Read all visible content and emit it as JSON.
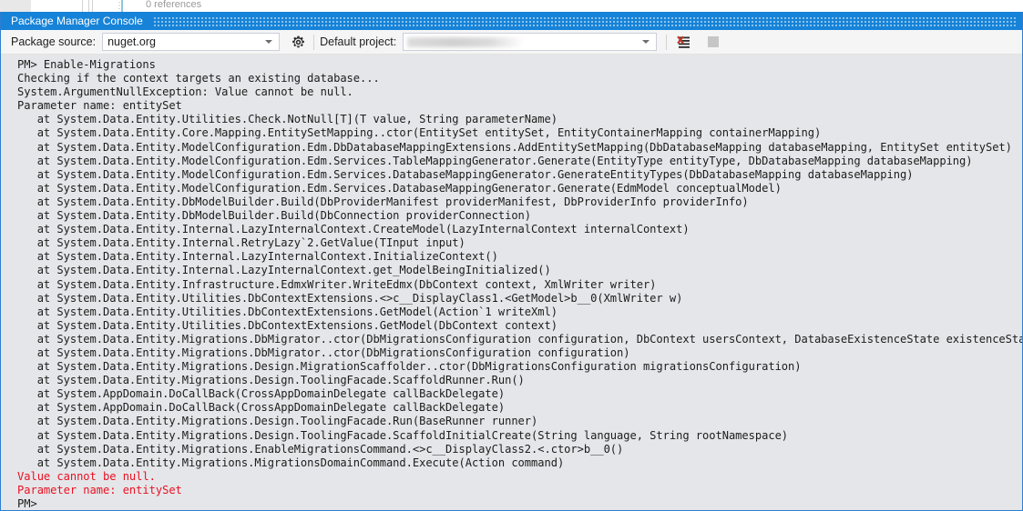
{
  "editor_sliver": {
    "codelens_text": "0 references",
    "dots_glyph": "⋮"
  },
  "toolwindow": {
    "title": "Package Manager Console",
    "title_bar_color": "#1683d8",
    "background_color": "#e5e6e9"
  },
  "toolbar": {
    "package_source_label": "Package source:",
    "package_source_value": "nuget.org",
    "package_source_placeholder": "Select package source",
    "settings_icon": "gear-icon",
    "default_project_label": "Default project:",
    "default_project_value": "",
    "default_project_placeholder": "Select project",
    "clear_console_icon": "clear-console-icon",
    "stop_icon": "stop-icon"
  },
  "console": {
    "error_color": "#e81123",
    "text_color": "#1c1c1c",
    "lines": [
      {
        "text": "PM> Enable-Migrations",
        "error": false
      },
      {
        "text": "Checking if the context targets an existing database...",
        "error": false
      },
      {
        "text": "System.ArgumentNullException: Value cannot be null.",
        "error": false
      },
      {
        "text": "Parameter name: entitySet",
        "error": false
      },
      {
        "text": "   at System.Data.Entity.Utilities.Check.NotNull[T](T value, String parameterName)",
        "error": false
      },
      {
        "text": "   at System.Data.Entity.Core.Mapping.EntitySetMapping..ctor(EntitySet entitySet, EntityContainerMapping containerMapping)",
        "error": false
      },
      {
        "text": "   at System.Data.Entity.ModelConfiguration.Edm.DbDatabaseMappingExtensions.AddEntitySetMapping(DbDatabaseMapping databaseMapping, EntitySet entitySet)",
        "error": false
      },
      {
        "text": "   at System.Data.Entity.ModelConfiguration.Edm.Services.TableMappingGenerator.Generate(EntityType entityType, DbDatabaseMapping databaseMapping)",
        "error": false
      },
      {
        "text": "   at System.Data.Entity.ModelConfiguration.Edm.Services.DatabaseMappingGenerator.GenerateEntityTypes(DbDatabaseMapping databaseMapping)",
        "error": false
      },
      {
        "text": "   at System.Data.Entity.ModelConfiguration.Edm.Services.DatabaseMappingGenerator.Generate(EdmModel conceptualModel)",
        "error": false
      },
      {
        "text": "   at System.Data.Entity.DbModelBuilder.Build(DbProviderManifest providerManifest, DbProviderInfo providerInfo)",
        "error": false
      },
      {
        "text": "   at System.Data.Entity.DbModelBuilder.Build(DbConnection providerConnection)",
        "error": false
      },
      {
        "text": "   at System.Data.Entity.Internal.LazyInternalContext.CreateModel(LazyInternalContext internalContext)",
        "error": false
      },
      {
        "text": "   at System.Data.Entity.Internal.RetryLazy`2.GetValue(TInput input)",
        "error": false
      },
      {
        "text": "   at System.Data.Entity.Internal.LazyInternalContext.InitializeContext()",
        "error": false
      },
      {
        "text": "   at System.Data.Entity.Internal.LazyInternalContext.get_ModelBeingInitialized()",
        "error": false
      },
      {
        "text": "   at System.Data.Entity.Infrastructure.EdmxWriter.WriteEdmx(DbContext context, XmlWriter writer)",
        "error": false
      },
      {
        "text": "   at System.Data.Entity.Utilities.DbContextExtensions.<>c__DisplayClass1.<GetModel>b__0(XmlWriter w)",
        "error": false
      },
      {
        "text": "   at System.Data.Entity.Utilities.DbContextExtensions.GetModel(Action`1 writeXml)",
        "error": false
      },
      {
        "text": "   at System.Data.Entity.Utilities.DbContextExtensions.GetModel(DbContext context)",
        "error": false
      },
      {
        "text": "   at System.Data.Entity.Migrations.DbMigrator..ctor(DbMigrationsConfiguration configuration, DbContext usersContext, DatabaseExistenceState existenceState)",
        "error": false
      },
      {
        "text": "   at System.Data.Entity.Migrations.DbMigrator..ctor(DbMigrationsConfiguration configuration)",
        "error": false
      },
      {
        "text": "   at System.Data.Entity.Migrations.Design.MigrationScaffolder..ctor(DbMigrationsConfiguration migrationsConfiguration)",
        "error": false
      },
      {
        "text": "   at System.Data.Entity.Migrations.Design.ToolingFacade.ScaffoldRunner.Run()",
        "error": false
      },
      {
        "text": "   at System.AppDomain.DoCallBack(CrossAppDomainDelegate callBackDelegate)",
        "error": false
      },
      {
        "text": "   at System.AppDomain.DoCallBack(CrossAppDomainDelegate callBackDelegate)",
        "error": false
      },
      {
        "text": "   at System.Data.Entity.Migrations.Design.ToolingFacade.Run(BaseRunner runner)",
        "error": false
      },
      {
        "text": "   at System.Data.Entity.Migrations.Design.ToolingFacade.ScaffoldInitialCreate(String language, String rootNamespace)",
        "error": false
      },
      {
        "text": "   at System.Data.Entity.Migrations.EnableMigrationsCommand.<>c__DisplayClass2.<.ctor>b__0()",
        "error": false
      },
      {
        "text": "   at System.Data.Entity.Migrations.MigrationsDomainCommand.Execute(Action command)",
        "error": false
      },
      {
        "text": "Value cannot be null.",
        "error": true
      },
      {
        "text": "Parameter name: entitySet",
        "error": true
      },
      {
        "text": "PM>",
        "error": false
      }
    ]
  }
}
